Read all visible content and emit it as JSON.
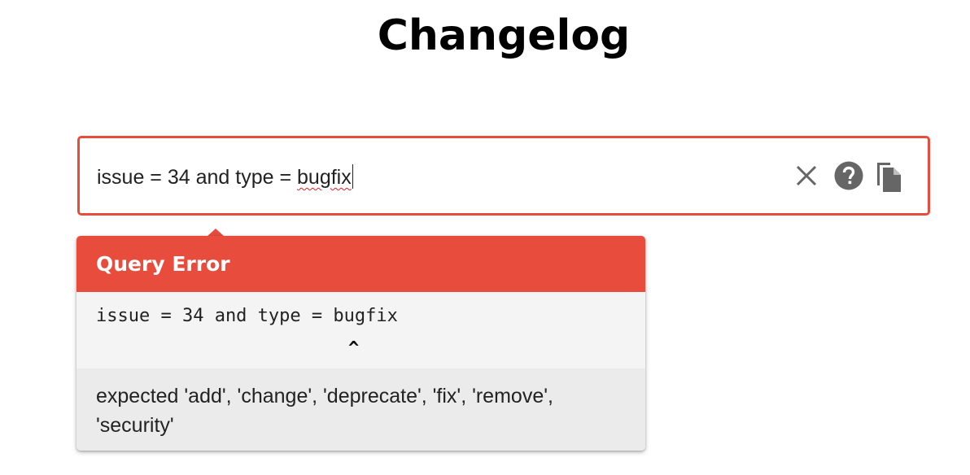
{
  "page": {
    "title": "Changelog"
  },
  "search": {
    "query_prefix": "issue = 34 and type = ",
    "query_error_token": "bugfix",
    "clear_icon": "close-icon",
    "help_icon": "help-circle-icon",
    "copy_icon": "copy-icon"
  },
  "error_popup": {
    "title": "Query Error",
    "query": "issue = 34 and type = bugfix",
    "pointer": "^",
    "message": "expected 'add', 'change', 'deprecate', 'fix', 'remove', 'security'"
  },
  "colors": {
    "error_accent": "#e84c3d",
    "icon_gray": "#666666"
  }
}
